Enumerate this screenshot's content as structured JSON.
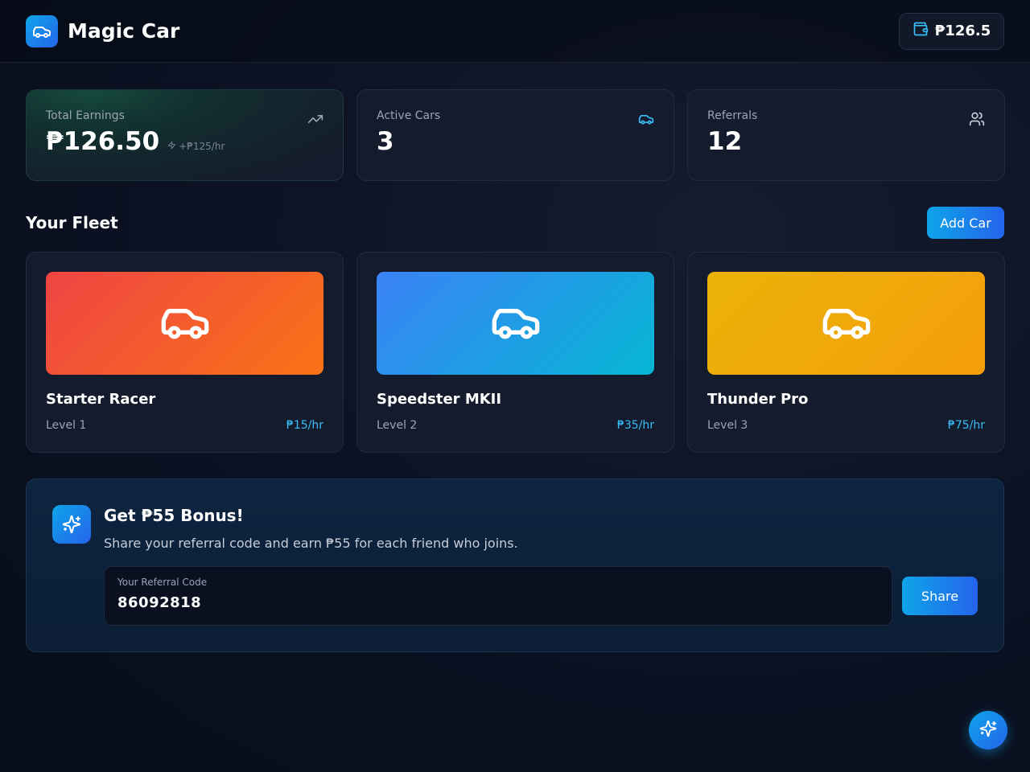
{
  "header": {
    "title": "Magic Car",
    "logo_icon": "car-icon",
    "wallet_balance": "₱126.5",
    "wallet_icon": "wallet-icon"
  },
  "stats": [
    {
      "label": "Total Earnings",
      "value": "₱126.50",
      "sub": "+₱125/hr",
      "icon": "trending-up-icon"
    },
    {
      "label": "Active Cars",
      "value": "3",
      "icon": "car-icon"
    },
    {
      "label": "Referrals",
      "value": "12",
      "icon": "users-icon"
    }
  ],
  "fleet": {
    "title": "Your Fleet",
    "add_label": "Add Car",
    "cars": [
      {
        "name": "Starter Racer",
        "level": "Level 1",
        "rate": "₱15/hr",
        "color_from": "#ef4444",
        "color_to": "#f97316"
      },
      {
        "name": "Speedster MKII",
        "level": "Level 2",
        "rate": "₱35/hr",
        "color_from": "#3b82f6",
        "color_to": "#06b6d4"
      },
      {
        "name": "Thunder Pro",
        "level": "Level 3",
        "rate": "₱75/hr",
        "color_from": "#eab308",
        "color_to": "#f59e0b"
      }
    ]
  },
  "bonus": {
    "title": "Get ₱55 Bonus!",
    "description": "Share your referral code and earn ₱55 for each friend who joins.",
    "code_label": "Your Referral Code",
    "code": "86092818",
    "share_label": "Share",
    "icon": "sparkles-icon"
  },
  "colors": {
    "accent": "#0ea5e9",
    "accent_dark": "#2563eb",
    "rate": "#38bdf8"
  }
}
